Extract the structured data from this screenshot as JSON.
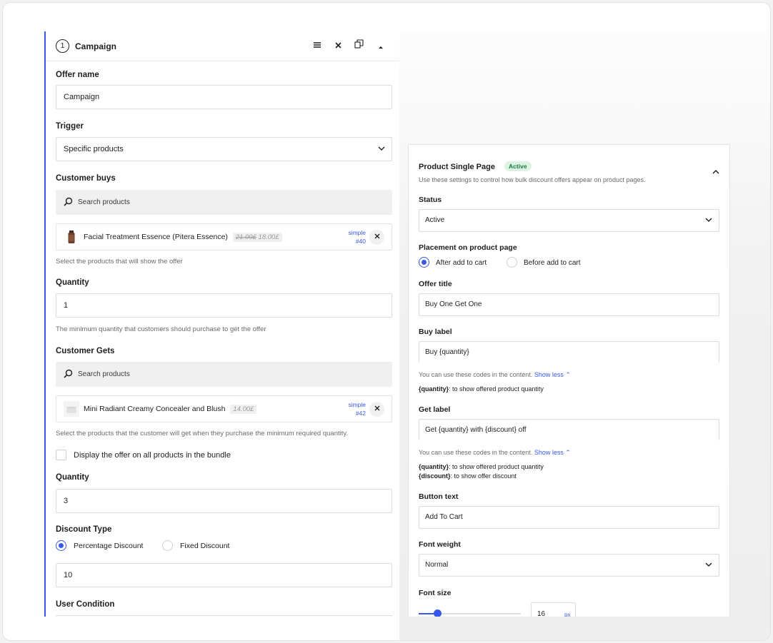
{
  "campaign": {
    "step_number": "1",
    "title": "Campaign",
    "offer_name": {
      "label": "Offer name",
      "value": "Campaign"
    },
    "trigger": {
      "label": "Trigger",
      "value": "Specific products"
    },
    "customer_buys": {
      "label": "Customer buys",
      "search_placeholder": "Search products",
      "product": {
        "name": "Facial Treatment Essence (Pitera Essence)",
        "price_old": "21.00£",
        "price_new": "18.00£",
        "type": "simple",
        "id": "#40"
      },
      "help": "Select the products that will show the offer"
    },
    "quantity_buy": {
      "label": "Quantity",
      "value": "1",
      "help": "The minimum quantity that customers should purchase to get the offer"
    },
    "customer_gets": {
      "label": "Customer Gets",
      "search_placeholder": "Search products",
      "product": {
        "name": "Mini Radiant Creamy Concealer and Blush",
        "price": "14.00£",
        "type": "simple",
        "id": "#42"
      },
      "help": "Select the products that the customer will get when they purchase the minimum required quantity."
    },
    "display_all_label": "Display the offer on all products in the bundle",
    "quantity_get": {
      "label": "Quantity",
      "value": "3"
    },
    "discount_type": {
      "label": "Discount Type",
      "options": [
        "Percentage Discount",
        "Fixed Discount"
      ],
      "selected": "Percentage Discount",
      "value": "10"
    },
    "user_condition_label": "User Condition"
  },
  "product_page": {
    "title": "Product Single Page",
    "badge": "Active",
    "description": "Use these settings to control how bulk discount offers appear on product pages.",
    "status": {
      "label": "Status",
      "value": "Active"
    },
    "placement": {
      "label": "Placement on product page",
      "options": [
        "After add to cart",
        "Before add to cart"
      ],
      "selected": "After add to cart"
    },
    "offer_title": {
      "label": "Offer title",
      "value": "Buy One Get One"
    },
    "buy_label": {
      "label": "Buy label",
      "value": "Buy {quantity}",
      "help": "You can use these codes in the content.",
      "toggle": "Show less ⌃",
      "codes": [
        {
          "code": "{quantity}",
          "desc": ": to show offered product quantity"
        }
      ]
    },
    "get_label": {
      "label": "Get label",
      "value": "Get {quantity} with {discount} off",
      "help": "You can use these codes in the content.",
      "toggle": "Show less ⌃",
      "codes": [
        {
          "code": "{quantity}",
          "desc": ": to show offered product quantity"
        },
        {
          "code": "{discount}",
          "desc": ": to show offer discount"
        }
      ]
    },
    "button_text": {
      "label": "Button text",
      "value": "Add To Cart"
    },
    "font_weight": {
      "label": "Font weight",
      "value": "Normal"
    },
    "font_size": {
      "label": "Font size",
      "value": "16",
      "unit": "px",
      "slider_fraction": 0.18
    }
  },
  "colors": {
    "accent": "#3858e9",
    "badge_bg": "#dcf3e4",
    "badge_text": "#1b7a3e"
  }
}
